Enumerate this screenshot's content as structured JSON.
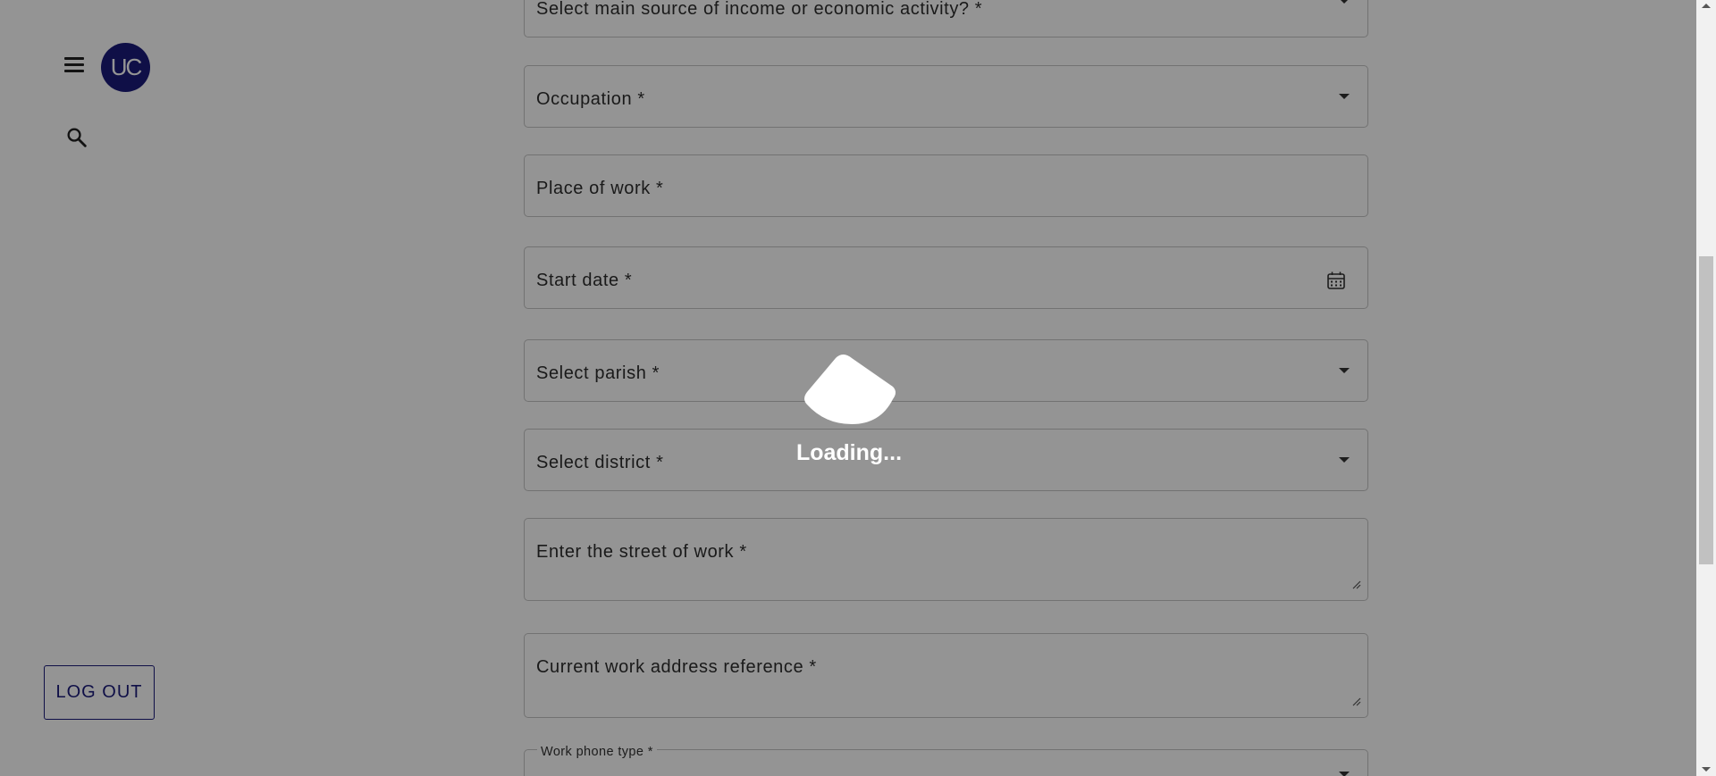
{
  "sidebar": {
    "avatar_text": "UC",
    "logout_label": "LOG OUT"
  },
  "form": {
    "fields": [
      {
        "label": "Select main source of income or economic activity? *",
        "type": "select"
      },
      {
        "label": "Occupation *",
        "type": "select"
      },
      {
        "label": "Place of work *",
        "type": "text"
      },
      {
        "label": "Start date *",
        "type": "date"
      },
      {
        "label": "Select parish *",
        "type": "select"
      },
      {
        "label": "Select district *",
        "type": "select"
      },
      {
        "label": "Enter the street of work *",
        "type": "textarea"
      },
      {
        "label": "Current work address reference *",
        "type": "textarea"
      },
      {
        "label": "Work phone type *",
        "type": "select"
      }
    ]
  },
  "overlay": {
    "loading_text": "Loading..."
  },
  "icons": {
    "menu": "menu-icon",
    "search": "search-icon",
    "calendar": "calendar-icon",
    "dropdown": "chevron-down-icon",
    "resize": "resize-handle-icon",
    "loader": "loading-spinner-icon"
  },
  "colors": {
    "brand": "#1a1a7a",
    "overlay": "rgba(0,0,0,0.42)"
  }
}
